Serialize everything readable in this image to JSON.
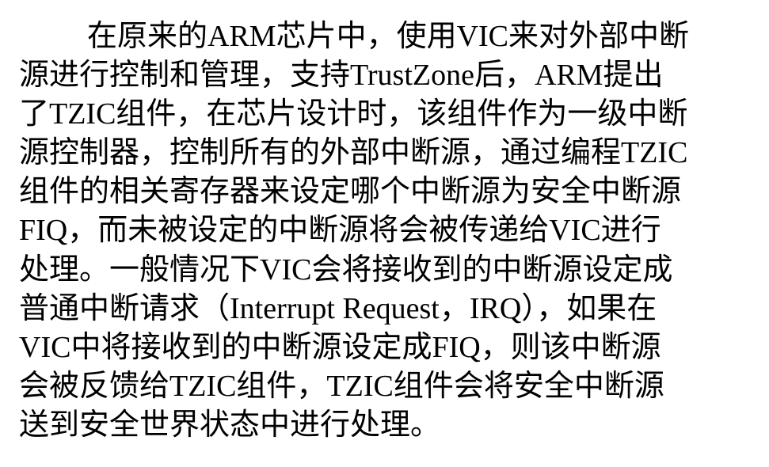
{
  "document": {
    "lines": [
      "在原来的ARM芯片中，使用VIC来对外部中断",
      "源进行控制和管理，支持TrustZone后，ARM提出",
      "了TZIC组件，在芯片设计时，该组件作为一级中断",
      "源控制器，控制所有的外部中断源，通过编程TZIC",
      "组件的相关寄存器来设定哪个中断源为安全中断源",
      "FIQ，而未被设定的中断源将会被传递给VIC进行",
      "处理。一般情况下VIC会将接收到的中断源设定成",
      "普通中断请求（Interrupt Request，IRQ），如果在",
      "VIC中将接收到的中断源设定成FIQ，则该中断源",
      "会被反馈给TZIC组件，TZIC组件会将安全中断源",
      "送到安全世界状态中进行处理。"
    ]
  }
}
